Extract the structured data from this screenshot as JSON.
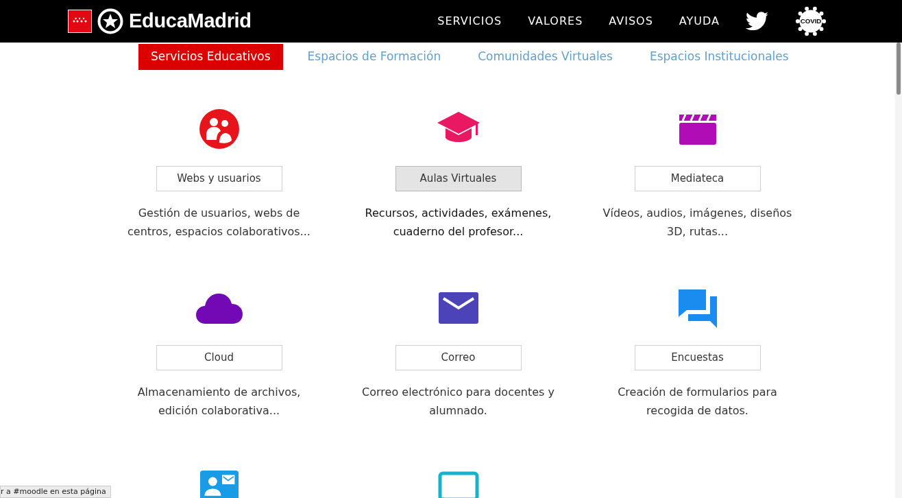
{
  "header": {
    "logo_text": "EducaMadrid",
    "nav": [
      "SERVICIOS",
      "VALORES",
      "AVISOS",
      "AYUDA"
    ],
    "covid_label": "COVID"
  },
  "tabs": [
    {
      "label": "Servicios Educativos",
      "selected": true
    },
    {
      "label": "Espacios de Formación",
      "selected": false
    },
    {
      "label": "Comunidades Virtuales",
      "selected": false
    },
    {
      "label": "Espacios Institucionales",
      "selected": false
    }
  ],
  "services": [
    {
      "name": "Webs y usuarios",
      "description": "Gestión de usuarios, webs de centros, espacios colaborativos...",
      "color": "#e8141b",
      "hovered": false
    },
    {
      "name": "Aulas Virtuales",
      "description": "Recursos, actividades, exámenes, cuaderno del profesor...",
      "color": "#ea1863",
      "hovered": true
    },
    {
      "name": "Mediateca",
      "description": "Vídeos, audios, imágenes, diseños 3D, rutas...",
      "color": "#b00db6",
      "hovered": false
    },
    {
      "name": "Cloud",
      "description": "Almacenamiento de archivos, edición colaborativa...",
      "color": "#7309b5",
      "hovered": false
    },
    {
      "name": "Correo",
      "description": "Correo electrónico para docentes y alumnado.",
      "color": "#4b43b7",
      "hovered": false
    },
    {
      "name": "Encuestas",
      "description": "Creación de formularios para recogida de datos.",
      "color": "#1a8cf0",
      "hovered": false
    },
    {
      "color": "#1a9be6"
    },
    {
      "color": "#19b2cb"
    }
  ],
  "status_bar": "r a #moodle en esta página"
}
